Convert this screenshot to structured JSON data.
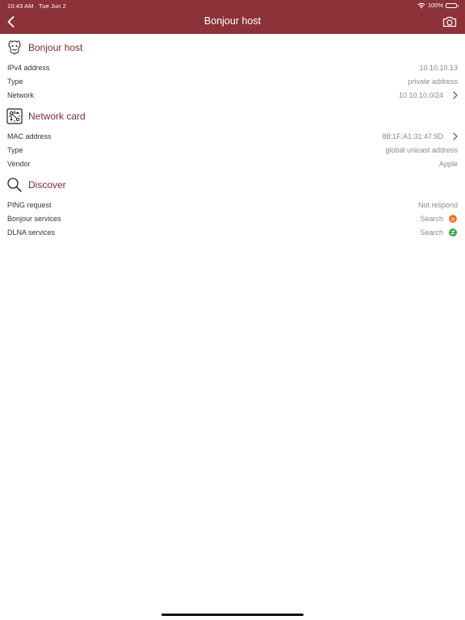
{
  "status_bar": {
    "time": "10:43 AM",
    "date": "Tue Jun 2",
    "battery": "100%"
  },
  "nav": {
    "title": "Bonjour host",
    "back_icon": "chevron-left-icon",
    "camera_icon": "camera-icon"
  },
  "colors": {
    "accent": "#8c3239",
    "section_title": "#7a2c33",
    "value_text": "#8a8a8a",
    "bonjour_badge": "#e8701f",
    "dlna_badge": "#22a33e"
  },
  "sections": {
    "bonjour": {
      "title": "Bonjour host",
      "icon": "bonjour-icon",
      "rows": [
        {
          "label": "IPv4 address",
          "value": "10.10.10.13"
        },
        {
          "label": "Type",
          "value": "private address"
        },
        {
          "label": "Network",
          "value": "10.10.10.0/24"
        }
      ]
    },
    "network_card": {
      "title": "Network card",
      "icon": "network-card-icon",
      "rows": [
        {
          "label": "MAC address",
          "value": "88:1F:A1:31:47:9D"
        },
        {
          "label": "Type",
          "value": "global unicast address"
        },
        {
          "label": "Vendor",
          "value": "Apple"
        }
      ]
    },
    "discover": {
      "title": "Discover",
      "icon": "search-icon",
      "rows": [
        {
          "label": "PING request",
          "value": "Not respond"
        },
        {
          "label": "Bonjour services",
          "value": "Search"
        },
        {
          "label": "DLNA services",
          "value": "Search"
        }
      ]
    }
  }
}
